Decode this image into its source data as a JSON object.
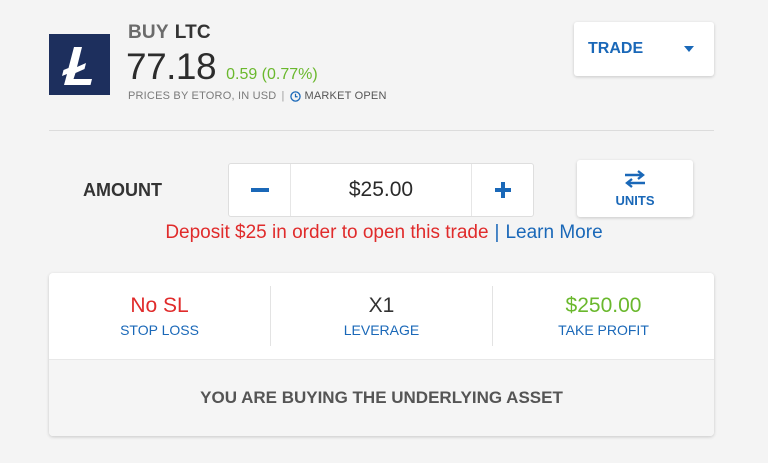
{
  "instrument": {
    "action": "BUY",
    "symbol": "LTC",
    "price": "77.18",
    "change": "0.59 (0.77%)",
    "source_note": "PRICES BY ETORO, IN USD",
    "separator": "|",
    "market_status": "MARKET OPEN",
    "logo_icon": "litecoin-icon",
    "logo_color": "#1d2f5d",
    "change_color": "#6ab82d"
  },
  "trade_dropdown": {
    "label": "TRADE",
    "icon": "chevron-down-icon"
  },
  "amount": {
    "label": "AMOUNT",
    "value": "$25.00",
    "decrement_icon": "minus-icon",
    "increment_icon": "plus-icon"
  },
  "units_toggle": {
    "label": "UNITS",
    "icon": "swap-arrows-icon"
  },
  "deposit_notice": {
    "message": "Deposit $25 in order to open this trade",
    "separator": "|",
    "link": "Learn More"
  },
  "order_settings": {
    "stop_loss": {
      "value": "No SL",
      "label": "STOP LOSS"
    },
    "leverage": {
      "value": "X1",
      "label": "LEVERAGE"
    },
    "take_profit": {
      "value": "$250.00",
      "label": "TAKE PROFIT"
    },
    "footer_text": "YOU ARE BUYING THE UNDERLYING ASSET"
  },
  "colors": {
    "accent": "#1a68b8",
    "negative": "#e02b2b",
    "positive": "#6ab82d"
  }
}
